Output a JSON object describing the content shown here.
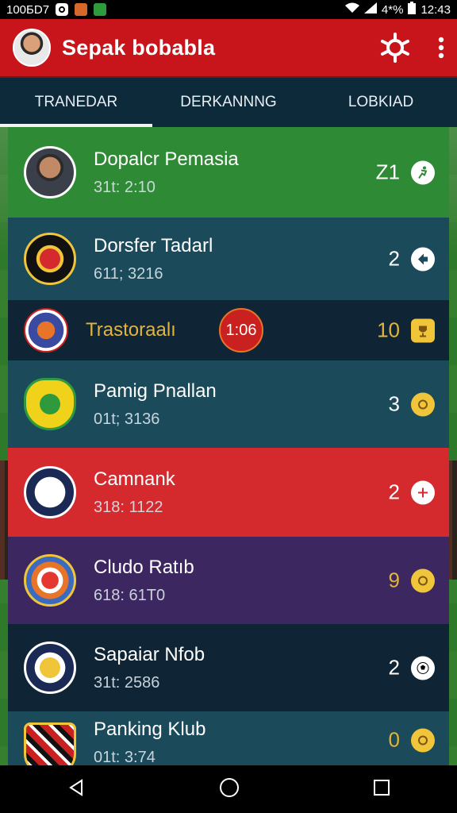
{
  "status_bar": {
    "left_text": "100БD7",
    "battery": "4*%",
    "time": "12:43"
  },
  "app": {
    "title": "Sepak bobabla"
  },
  "tabs": [
    {
      "label": "TRANEDAR",
      "active": true
    },
    {
      "label": "DERKANNNG",
      "active": false
    },
    {
      "label": "LOBKIAD",
      "active": false
    }
  ],
  "rows": [
    {
      "name": "Dopalcr Pemasia",
      "sub": "31t: 2:10",
      "score": "Z1",
      "icon": "running-icon",
      "bg": "#2f8a35"
    },
    {
      "name": "Dorsfer Tadarl",
      "sub": "611; 3216",
      "score": "2",
      "icon": "arrow-icon",
      "bg": "#1b4a5a"
    },
    {
      "name": "Trastoraalı",
      "live": "1:06",
      "score": "10",
      "icon": "trophy-icon",
      "bg": "#0f2536"
    },
    {
      "name": "Pamig Pnallan",
      "sub": "01t; 3136",
      "score": "3",
      "icon": "ball-icon",
      "bg": "#1b4a5a"
    },
    {
      "name": "Camnank",
      "sub": "318: 1122",
      "score": "2",
      "icon": "plus-icon",
      "bg": "#d42a2e"
    },
    {
      "name": "Cludo Ratıb",
      "sub": "618: 61T0",
      "score": "9",
      "icon": "ball-icon",
      "bg": "#3d2760"
    },
    {
      "name": "Sapaiar Nfob",
      "sub": "31t: 2586",
      "score": "2",
      "icon": "soccer-ball-icon",
      "bg": "#0f2536"
    },
    {
      "name": "Panking Klub",
      "sub": "01t: 3:74",
      "score": "0",
      "icon": "ball-icon",
      "bg": "#1b4a5a"
    }
  ]
}
